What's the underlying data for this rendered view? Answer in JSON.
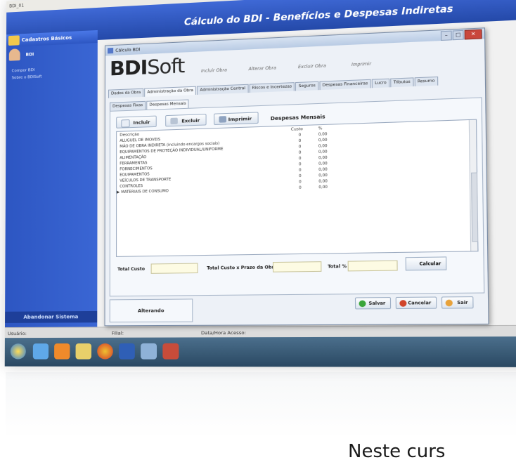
{
  "window": {
    "top_strip": "BDI_01",
    "banner_title": "Cálculo do BDI - Benefícios e Despesas Indiretas"
  },
  "sidebar": {
    "header": "Cadastros Básicos",
    "user": "BDI",
    "links": [
      "Compor BDI",
      "Sobre o BDISoft"
    ],
    "footer": "Abandonar Sistema"
  },
  "statusbar": {
    "user_label": "Usuário:",
    "filial_label": "Filial:",
    "datetime_label": "Data/Hora Acesso:"
  },
  "dialog": {
    "title": "Cálculo BDI",
    "logo_bold": "BDI",
    "logo_rest": "Soft",
    "top_buttons": [
      "Incluir Obra",
      "Alterar Obra",
      "Excluir Obra",
      "Imprimir"
    ],
    "tabs": [
      "Dados da Obra",
      "Administração da Obra",
      "Administração Central",
      "Riscos e Incertezas",
      "Seguros",
      "Despesas Financeiras",
      "Lucro",
      "Tributos",
      "Resumo"
    ],
    "active_tab": 1,
    "subtabs": [
      "Despesas Fixas",
      "Despesas Mensais"
    ],
    "active_subtab": 1,
    "toolbar": {
      "include": "Incluir",
      "delete": "Excluir",
      "print": "Imprimir"
    },
    "section_title": "Despesas Mensais",
    "grid": {
      "headers": {
        "description": "Descrição",
        "cost": "Custo",
        "percent": "%"
      },
      "rows": [
        {
          "desc": "ALUGUEL DE IMOVEIS",
          "cost": "0",
          "pct": "0,00"
        },
        {
          "desc": "MÃO DE OBRA INDIRETA (incluindo encargos sociais)",
          "cost": "0",
          "pct": "0,00"
        },
        {
          "desc": "EQUIPAMENTOS DE PROTEÇÃO INDIVIDUAL/UNIFORME",
          "cost": "0",
          "pct": "0,00"
        },
        {
          "desc": "ALIMENTAÇÃO",
          "cost": "0",
          "pct": "0,00"
        },
        {
          "desc": "FERRAMENTAS",
          "cost": "0",
          "pct": "0,00"
        },
        {
          "desc": "FORNECIMENTOS",
          "cost": "0",
          "pct": "0,00"
        },
        {
          "desc": "EQUIPAMENTOS",
          "cost": "0",
          "pct": "0,00"
        },
        {
          "desc": "VEÍCULOS DE TRANSPORTE",
          "cost": "0",
          "pct": "0,00"
        },
        {
          "desc": "CONTROLES",
          "cost": "0",
          "pct": "0,00"
        },
        {
          "desc": "MATERIAIS DE CONSUMO",
          "cost": "0",
          "pct": "0,00"
        }
      ]
    },
    "totals": {
      "total_cost": "Total Custo",
      "total_cost_term": "Total Custo x Prazo da Obra",
      "total_pct": "Total %",
      "calculate": "Calcular"
    },
    "status": "Alterando",
    "actions": {
      "save": "Salvar",
      "cancel": "Cancelar",
      "exit": "Sair"
    }
  },
  "caption": "Neste curs",
  "colors": {
    "banner": "#2f5bc7",
    "sidebar": "#2d56c2",
    "save_icon": "#3aa53a",
    "cancel_icon": "#d0442a",
    "exit_icon": "#e8a23a"
  }
}
